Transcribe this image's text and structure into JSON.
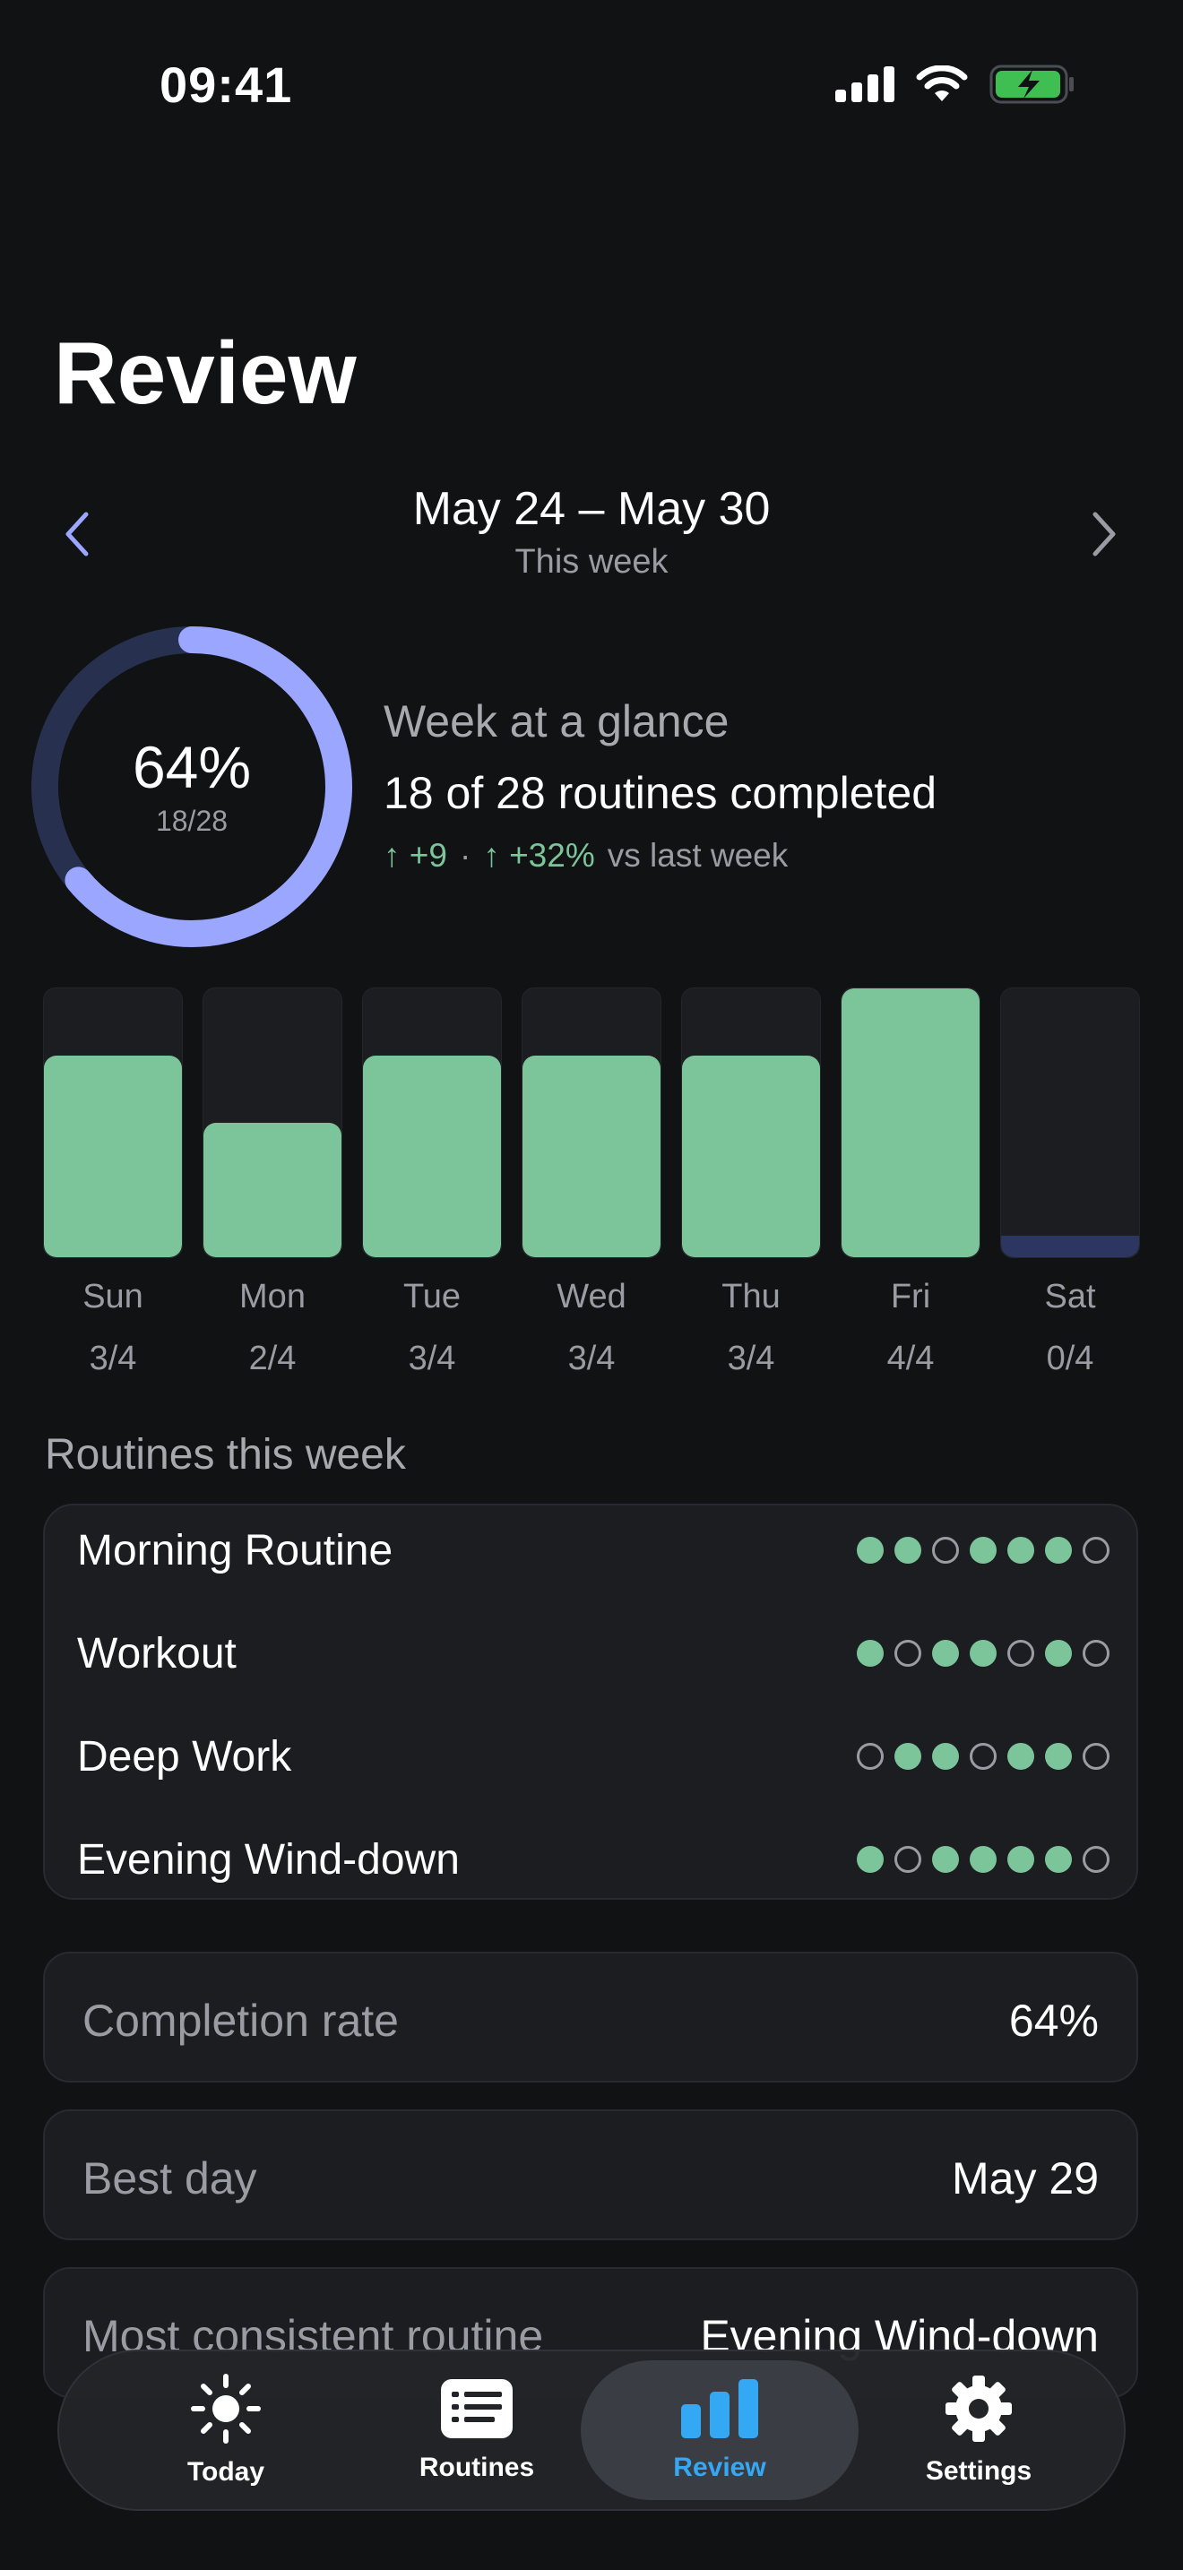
{
  "status_bar": {
    "time": "09:41"
  },
  "header": {
    "title": "Review"
  },
  "week_nav": {
    "range": "May 24 – May 30",
    "subtitle": "This week"
  },
  "summary": {
    "percent": "64%",
    "fraction": "18/28",
    "progress": 0.64,
    "title": "Week at a glance",
    "main": "18 of 28 routines completed",
    "delta_count": "↑ +9",
    "separator": "·",
    "delta_pct": "↑ +32%",
    "delta_suffix": "vs last week"
  },
  "days": [
    {
      "label": "Sun",
      "score": "3/4",
      "fraction": 0.75
    },
    {
      "label": "Mon",
      "score": "2/4",
      "fraction": 0.5
    },
    {
      "label": "Tue",
      "score": "3/4",
      "fraction": 0.75
    },
    {
      "label": "Wed",
      "score": "3/4",
      "fraction": 0.75
    },
    {
      "label": "Thu",
      "score": "3/4",
      "fraction": 0.75
    },
    {
      "label": "Fri",
      "score": "4/4",
      "fraction": 1.0
    },
    {
      "label": "Sat",
      "score": "0/4",
      "fraction": 0
    }
  ],
  "routines_section": {
    "title": "Routines this week",
    "items": [
      {
        "name": "Morning Routine",
        "days": [
          1,
          1,
          0,
          1,
          1,
          1,
          0
        ]
      },
      {
        "name": "Workout",
        "days": [
          1,
          0,
          1,
          1,
          0,
          1,
          0
        ]
      },
      {
        "name": "Deep Work",
        "days": [
          0,
          1,
          1,
          0,
          1,
          1,
          0
        ]
      },
      {
        "name": "Evening Wind-down",
        "days": [
          1,
          0,
          1,
          1,
          1,
          1,
          0
        ]
      }
    ]
  },
  "stats": [
    {
      "label": "Completion rate",
      "value": "64%"
    },
    {
      "label": "Best day",
      "value": "May 29"
    },
    {
      "label": "Most consistent routine",
      "value": "Evening Wind-down"
    }
  ],
  "tabbar": {
    "tabs": [
      {
        "label": "Today",
        "icon": "sun-icon"
      },
      {
        "label": "Routines",
        "icon": "list-icon"
      },
      {
        "label": "Review",
        "icon": "bar-chart-icon",
        "active": true
      },
      {
        "label": "Settings",
        "icon": "gear-icon"
      }
    ]
  },
  "colors": {
    "accent": "#9ba6ff",
    "success": "#7cc49a",
    "active_tab": "#35a8f3",
    "background": "#111214"
  }
}
